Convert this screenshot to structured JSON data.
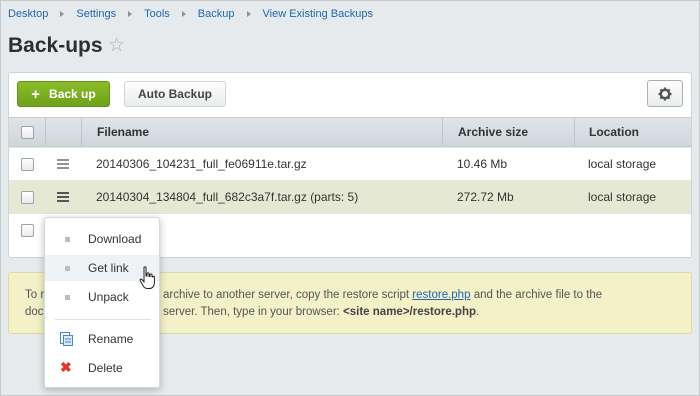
{
  "breadcrumb": [
    "Desktop",
    "Settings",
    "Tools",
    "Backup",
    "View Existing Backups"
  ],
  "page_title": "Back-ups",
  "toolbar": {
    "backup_label": "Back up",
    "auto_backup_label": "Auto Backup"
  },
  "table": {
    "columns": [
      "Filename",
      "Archive size",
      "Location"
    ],
    "rows": [
      {
        "filename": "20140306_104231_full_fe06911e.tar.gz",
        "size": "10.46 Mb",
        "location": "local storage"
      },
      {
        "filename": "20140304_134804_full_682c3a7f.tar.gz (parts: 5)",
        "size": "272.72 Mb",
        "location": "local storage"
      }
    ]
  },
  "info": {
    "line1_start": "To r",
    "line1_end": "archive to another server, copy the restore script",
    "link": "restore.php",
    "line1_tail": "and the archive file to the",
    "line2_start": "doc",
    "line2_end": "server. Then, type in your browser:",
    "line2_bold": "<site name>/restore.php",
    "line2_dot": "."
  },
  "popup_menu": {
    "items": [
      "Download",
      "Get link",
      "Unpack"
    ],
    "actions": [
      "Rename",
      "Delete"
    ]
  },
  "colors": {
    "accent_green": "#7ab122",
    "link_blue": "#2067b0",
    "highlight_row": "#e5e9d3",
    "info_bg": "#f3f1c8",
    "delete_red": "#e0392b"
  },
  "icons": [
    "star-icon",
    "plus-icon",
    "gear-icon",
    "hamburger-icon",
    "rename-icon",
    "delete-icon",
    "cursor-icon"
  ]
}
